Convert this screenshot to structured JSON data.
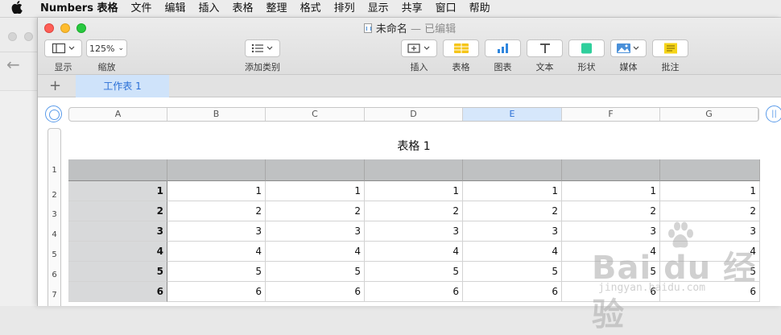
{
  "menubar": {
    "apple": "",
    "app": "Numbers 表格",
    "items": [
      "文件",
      "编辑",
      "插入",
      "表格",
      "整理",
      "格式",
      "排列",
      "显示",
      "共享",
      "窗口",
      "帮助"
    ]
  },
  "window": {
    "title": "未命名",
    "subtitle": " — 已编辑"
  },
  "toolbar": {
    "view_label": "显示",
    "zoom_value": "125%",
    "zoom_label": "缩放",
    "category_label": "添加类别",
    "insert_label": "插入",
    "table_label": "表格",
    "chart_label": "图表",
    "text_label": "文本",
    "shape_label": "形状",
    "media_label": "媒体",
    "comment_label": "批注"
  },
  "tabs": {
    "add": "+",
    "sheet": "工作表 1"
  },
  "columns": [
    "A",
    "B",
    "C",
    "D",
    "E",
    "F",
    "G"
  ],
  "selected_column": "E",
  "rows": [
    "1",
    "2",
    "3",
    "4",
    "5",
    "6",
    "7"
  ],
  "table": {
    "title": "表格 1",
    "header_row": [
      "",
      "",
      "",
      "",
      "",
      "",
      ""
    ],
    "body": [
      [
        "1",
        "1",
        "1",
        "1",
        "1",
        "1",
        "1"
      ],
      [
        "2",
        "2",
        "2",
        "2",
        "2",
        "2",
        "2"
      ],
      [
        "3",
        "3",
        "3",
        "3",
        "3",
        "3",
        "3"
      ],
      [
        "4",
        "4",
        "4",
        "4",
        "4",
        "4",
        "4"
      ],
      [
        "5",
        "5",
        "5",
        "5",
        "5",
        "5",
        "5"
      ],
      [
        "6",
        "6",
        "6",
        "6",
        "6",
        "6",
        "6"
      ]
    ]
  },
  "watermark": {
    "brand": "Bai du 经验",
    "url": "jingyan.baidu.com"
  },
  "colors": {
    "accent": "#2a6fd6",
    "close": "#fe5f57",
    "minimize": "#febc2e",
    "zoom": "#28c840",
    "table_icon": "#f5c518",
    "chart_icon": "#2f86de",
    "shape_icon": "#2fcf9c",
    "media_icon": "#4a90d9",
    "comment_icon": "#f5d418"
  }
}
